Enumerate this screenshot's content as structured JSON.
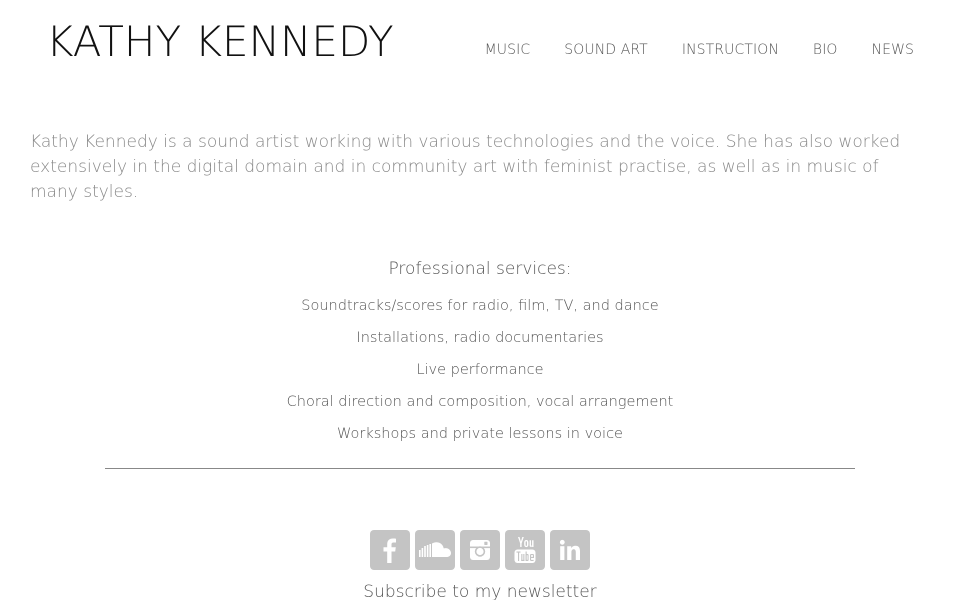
{
  "header": {
    "site_title": "KATHY KENNEDY",
    "nav": [
      "MUSIC",
      "SOUND ART",
      "INSTRUCTION",
      "BIO",
      "NEWS"
    ]
  },
  "intro": {
    "text": "Kathy Kennedy is a sound artist working with various technologies and the voice. She has also worked extensively in the digital domain and in community art with feminist practise, as well as in music of many styles."
  },
  "services": {
    "heading": "Professional services:",
    "items": [
      "Soundtracks/scores for radio, film, TV, and dance",
      "Installations, radio documentaries",
      "Live performance",
      "Choral direction and composition, vocal arrangement",
      "Workshops and private lessons in voice"
    ]
  },
  "social": {
    "icons": [
      "facebook-icon",
      "soundcloud-icon",
      "instagram-icon",
      "youtube-icon",
      "linkedin-icon"
    ],
    "button_color": "#c4c4c4"
  },
  "newsletter": {
    "label": "Subscribe to my newsletter"
  }
}
